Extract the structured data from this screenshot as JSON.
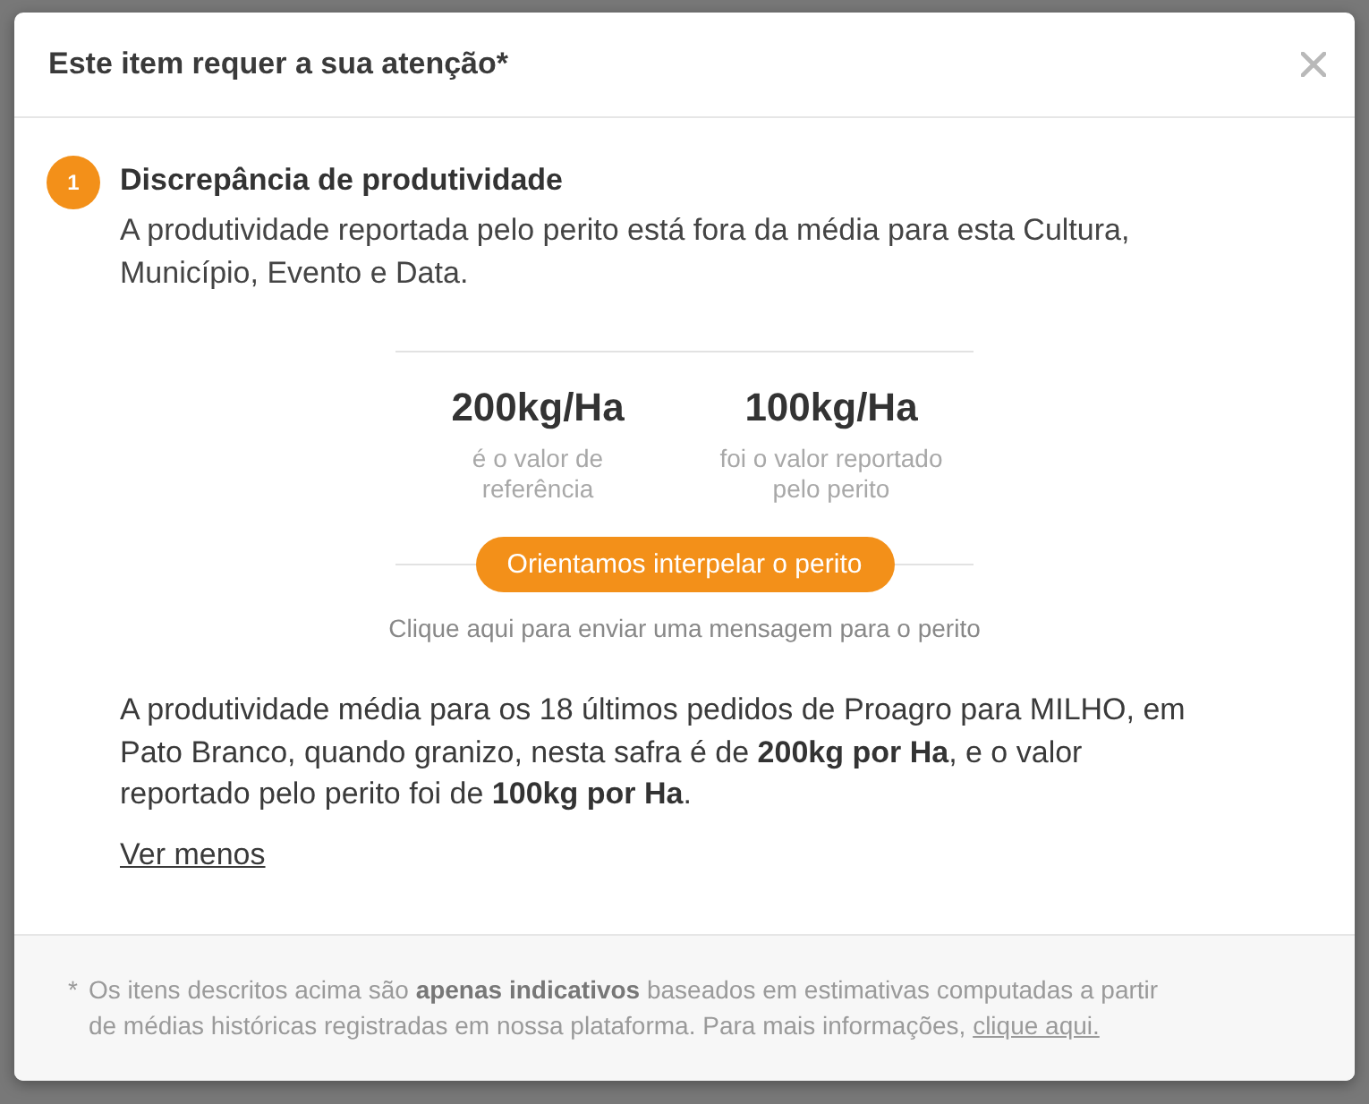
{
  "dialog": {
    "title": "Este item requer a sua atenção*"
  },
  "items": [
    {
      "number": "1",
      "title": "Discrepância de produtividade",
      "description": "A produtividade reportada pelo perito está fora da média para esta Cultura, Município, Evento e Data.",
      "comparison": [
        {
          "value": "200kg/Ha",
          "caption": "é o valor de referência"
        },
        {
          "value": "100kg/Ha",
          "caption": "foi o valor reportado pelo perito"
        }
      ],
      "action_button": "Orientamos interpelar o perito",
      "action_hint": "Clique aqui para enviar uma mensagem para o perito",
      "detail": "A produtividade média para os 18 últimos pedidos de Proagro para MILHO, em Pato Branco, quando granizo, nesta safra é de **200kg por Ha**, e o valor reportado pelo perito foi de **100kg por Ha**.",
      "toggle_link": "Ver menos"
    }
  ],
  "footnote": {
    "mark": "*",
    "text": "Os itens descritos acima são **apenas indicativos** baseados em estimativas computadas a partir de médias históricas registradas em nossa plataforma. Para mais informações,",
    "link": "clique aqui."
  }
}
